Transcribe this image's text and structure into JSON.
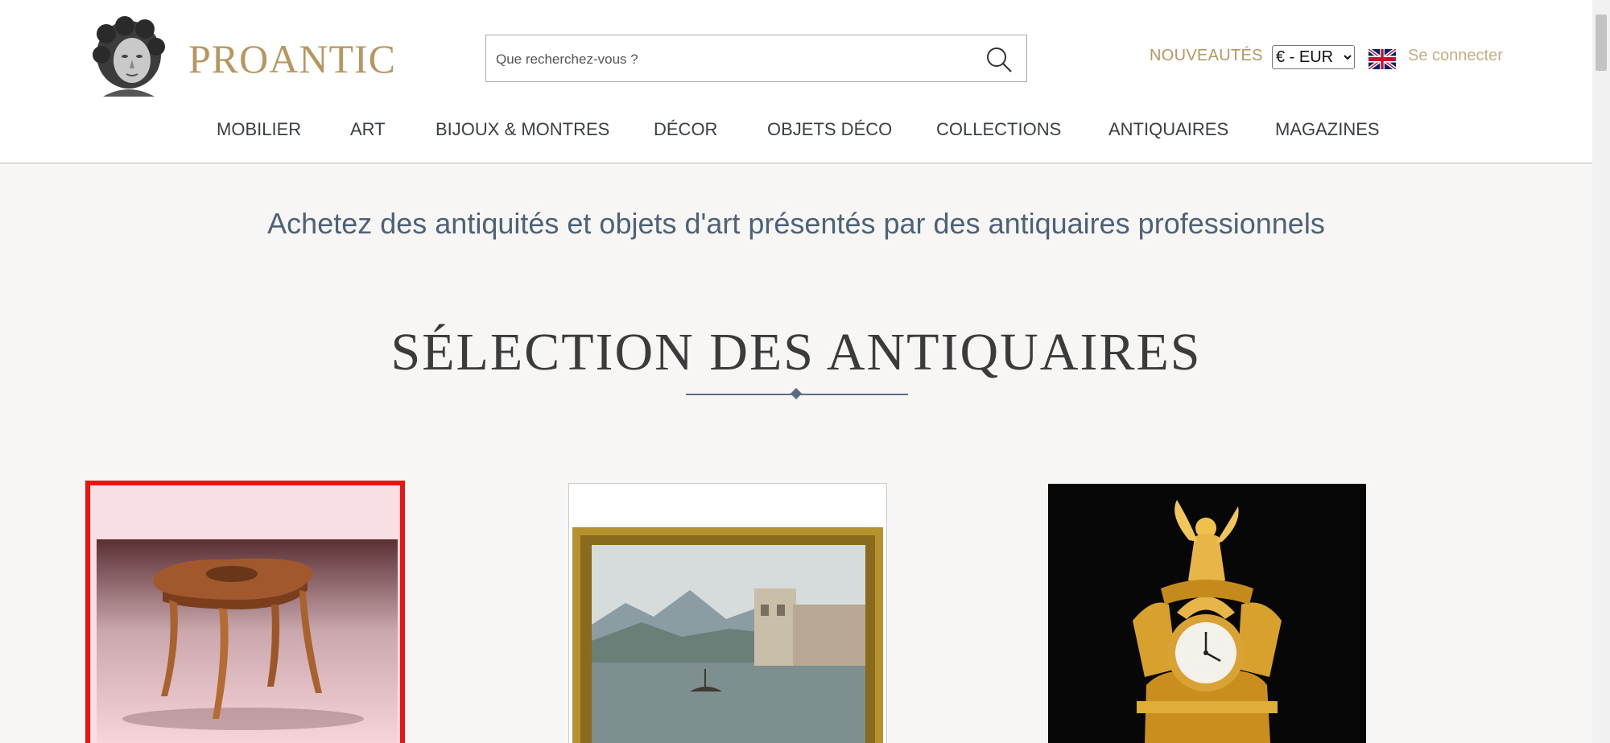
{
  "brand": {
    "name": "PROANTIC",
    "logo_icon": "sculpted-head-bust-icon",
    "color": "#b8965f"
  },
  "search": {
    "placeholder": "Que recherchez-vous ?",
    "value": "",
    "icon": "search-icon"
  },
  "header": {
    "nouveautes": "NOUVEAUTÉS",
    "currency": {
      "selected": "€ - EUR"
    },
    "language_icon": "uk-flag-icon",
    "login": "Se connecter"
  },
  "nav": {
    "items": [
      "MOBILIER",
      "ART",
      "BIJOUX & MONTRES",
      "DÉCOR",
      "OBJETS DÉCO",
      "COLLECTIONS",
      "ANTIQUAIRES",
      "MAGAZINES"
    ]
  },
  "main": {
    "tagline": "Achetez des antiquités et objets d'art présentés par des antiquaires professionnels",
    "section_title": "SÉLECTION DES ANTIQUAIRES"
  },
  "products": [
    {
      "image": "marquetry-table-photo",
      "selected": true
    },
    {
      "image": "framed-lake-painting-photo",
      "selected": false
    },
    {
      "image": "gilt-bronze-clock-photo",
      "selected": false
    }
  ],
  "colors": {
    "accent_gold": "#b8965f",
    "tagline_blue": "#4d6177",
    "selection_red": "#ee1313"
  }
}
